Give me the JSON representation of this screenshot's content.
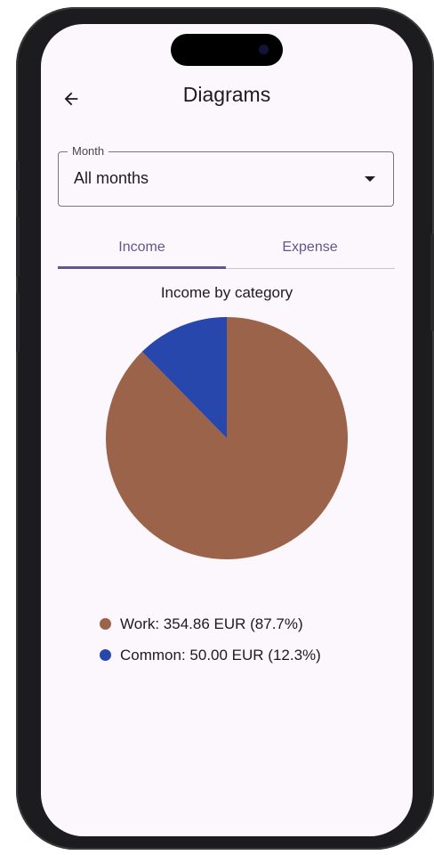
{
  "app_bar": {
    "title": "Diagrams",
    "back_icon": "arrow-left-icon"
  },
  "month_filter": {
    "label": "Month",
    "value": "All months",
    "dropdown_icon": "triangle-down-icon"
  },
  "tabs": [
    {
      "label": "Income",
      "selected": true
    },
    {
      "label": "Expense",
      "selected": false
    }
  ],
  "colors": {
    "work": "#9b634a",
    "common": "#2747ad",
    "accent": "#65558f"
  },
  "chart_data": {
    "type": "pie",
    "title": "Income by category",
    "currency": "EUR",
    "slices": [
      {
        "label": "Work",
        "value": 354.86,
        "percent": 87.7,
        "color": "#9b634a"
      },
      {
        "label": "Common",
        "value": 50.0,
        "percent": 12.3,
        "color": "#2747ad"
      }
    ],
    "legend_placement": "bottom",
    "legend": [
      "Work: 354.86 EUR (87.7%)",
      "Common: 50.00 EUR (12.3%)"
    ]
  }
}
